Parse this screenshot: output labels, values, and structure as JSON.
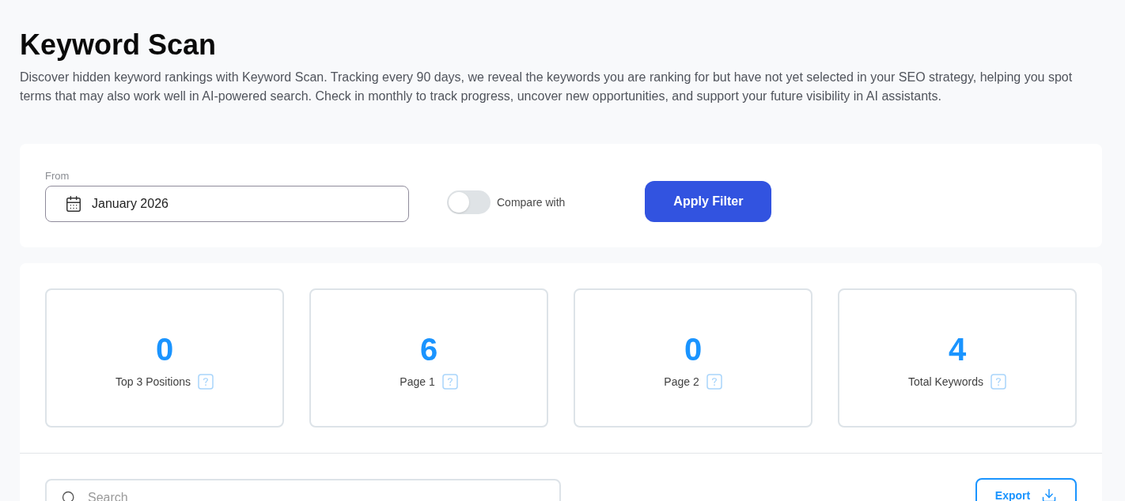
{
  "page": {
    "title": "Keyword Scan",
    "description": "Discover hidden keyword rankings with Keyword Scan. Tracking every 90 days, we reveal the keywords you are ranking for but have not yet selected in your SEO strategy, helping you spot terms that may also work well in AI-powered search. Check in monthly to track progress, uncover new opportunities, and support your future visibility in AI assistants."
  },
  "filter": {
    "from_label": "From",
    "date_value": "January 2026",
    "compare_toggle": {
      "label": "Compare with",
      "on": false
    },
    "apply_button": "Apply Filter"
  },
  "stats": [
    {
      "value": "0",
      "label": "Top 3 Positions"
    },
    {
      "value": "6",
      "label": "Page 1"
    },
    {
      "value": "0",
      "label": "Page 2"
    },
    {
      "value": "4",
      "label": "Total Keywords"
    }
  ],
  "toolbar": {
    "search": {
      "placeholder": "Search"
    },
    "export_button": "Export"
  }
}
